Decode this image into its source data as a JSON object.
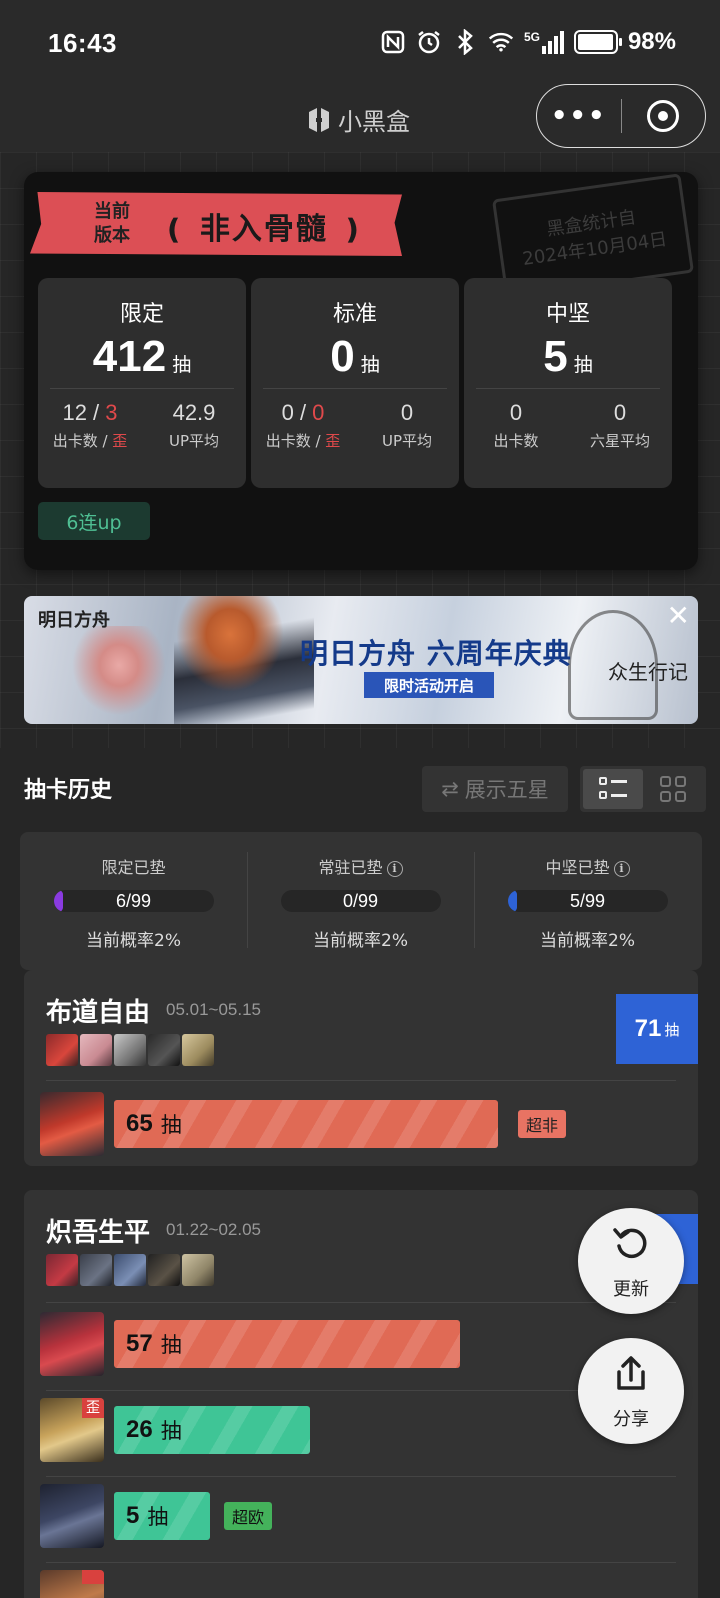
{
  "status_bar": {
    "time": "16:43",
    "signal": "5G",
    "battery": "98%",
    "battery_level": 0.98
  },
  "app": {
    "title": "小黑盒",
    "more": "•••"
  },
  "summary": {
    "version_label": "当前版本",
    "rating": "非入骨髓",
    "stamp_line1": "黑盒统计自",
    "stamp_line2": "2024年10月04日",
    "boxes": [
      {
        "title": "限定",
        "count": "412",
        "unit": "抽",
        "a_val": "12",
        "a_bad": "3",
        "a_label": "出卡数",
        "a_bad_label": "歪",
        "b_val": "42.9",
        "b_label": "UP平均"
      },
      {
        "title": "标准",
        "count": "0",
        "unit": "抽",
        "a_val": "0",
        "a_bad": "0",
        "a_label": "出卡数",
        "a_bad_label": "歪",
        "b_val": "0",
        "b_label": "UP平均"
      },
      {
        "title": "中坚",
        "count": "5",
        "unit": "抽",
        "a_val": "0",
        "a_label": "出卡数",
        "b_val": "0",
        "b_label": "六星平均"
      }
    ],
    "tag": "6连up"
  },
  "banner": {
    "logo": "明日方舟",
    "title": "明日方舟 六周年庆典",
    "subtitle": "限时活动开启",
    "deco": "众生行记",
    "close": "✕"
  },
  "history": {
    "title": "抽卡历史",
    "show_five_star": "展示五星",
    "pity": [
      {
        "label": "限定已垫",
        "value": "6/99",
        "fraction": 0.0606,
        "color": "#8a3be0",
        "rate": "当前概率2%",
        "info": false
      },
      {
        "label": "常驻已垫",
        "value": "0/99",
        "fraction": 0,
        "color": "#2e63d6",
        "rate": "当前概率2%",
        "info": true
      },
      {
        "label": "中坚已垫",
        "value": "5/99",
        "fraction": 0.0505,
        "color": "#2e63d6",
        "rate": "当前概率2%",
        "info": true
      }
    ],
    "pools": [
      {
        "name": "布道自由",
        "date": "05.01~05.15",
        "total": "71",
        "unit": "抽",
        "pulls": [
          {
            "count": "65",
            "unit": "抽",
            "type": "orange",
            "tag": "超非",
            "tag_type": "bad",
            "badge": ""
          }
        ]
      },
      {
        "name": "炽吾生平",
        "date": "01.22~02.05",
        "total": "65",
        "unit": "抽",
        "pulls": [
          {
            "count": "57",
            "unit": "抽",
            "type": "orange",
            "tag": "",
            "tag_type": "",
            "badge": ""
          },
          {
            "count": "26",
            "unit": "抽",
            "type": "green",
            "tag": "",
            "tag_type": "",
            "badge": "歪"
          },
          {
            "count": "5",
            "unit": "抽",
            "type": "green",
            "tag": "超欧",
            "tag_type": "good",
            "badge": ""
          }
        ]
      }
    ]
  },
  "fabs": {
    "refresh": "更新",
    "share": "分享"
  }
}
